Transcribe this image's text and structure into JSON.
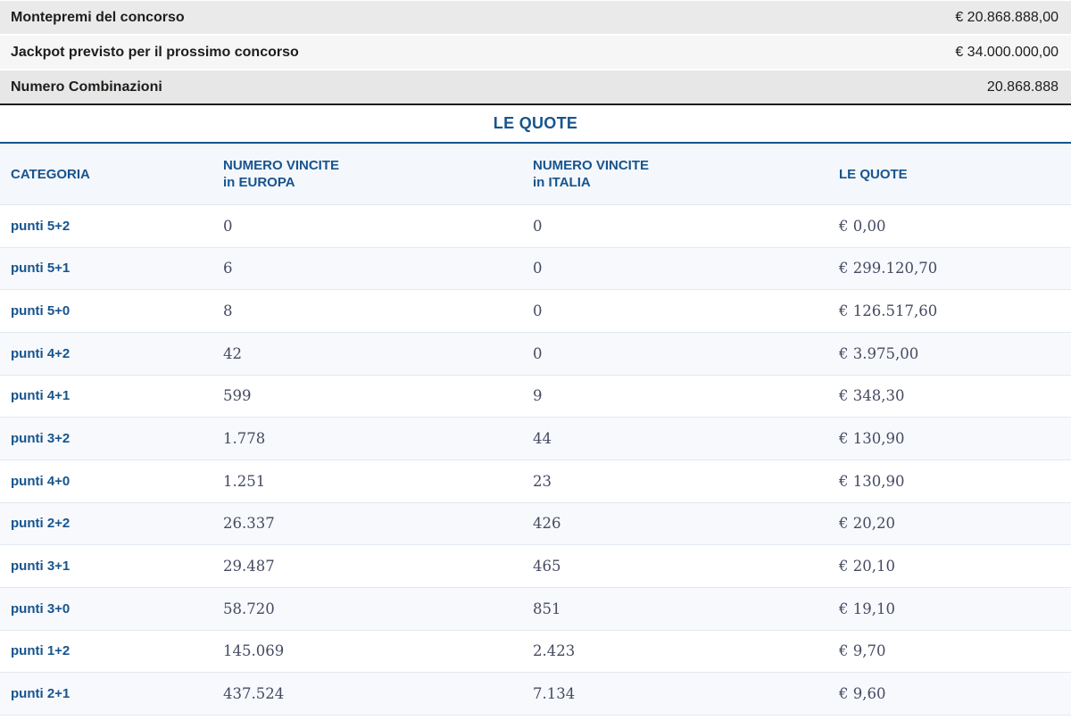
{
  "summary": {
    "rows": [
      {
        "label": "Montepremi del concorso",
        "value": "€ 20.868.888,00"
      },
      {
        "label": "Jackpot previsto per il prossimo concorso",
        "value": "€ 34.000.000,00"
      },
      {
        "label": "Numero Combinazioni",
        "value": "20.868.888"
      }
    ]
  },
  "section_title": "LE QUOTE",
  "table": {
    "columns": [
      {
        "label": "CATEGORIA"
      },
      {
        "line1": "NUMERO VINCITE",
        "line2": "in EUROPA"
      },
      {
        "line1": "NUMERO VINCITE",
        "line2": "in ITALIA"
      },
      {
        "label": "LE QUOTE"
      }
    ],
    "rows": [
      {
        "categoria": "punti 5+2",
        "vincite_europa": "0",
        "vincite_italia": "0",
        "quota": "€ 0,00"
      },
      {
        "categoria": "punti 5+1",
        "vincite_europa": "6",
        "vincite_italia": "0",
        "quota": "€ 299.120,70"
      },
      {
        "categoria": "punti 5+0",
        "vincite_europa": "8",
        "vincite_italia": "0",
        "quota": "€ 126.517,60"
      },
      {
        "categoria": "punti 4+2",
        "vincite_europa": "42",
        "vincite_italia": "0",
        "quota": "€ 3.975,00"
      },
      {
        "categoria": "punti 4+1",
        "vincite_europa": "599",
        "vincite_italia": "9",
        "quota": "€ 348,30"
      },
      {
        "categoria": "punti 3+2",
        "vincite_europa": "1.778",
        "vincite_italia": "44",
        "quota": "€ 130,90"
      },
      {
        "categoria": "punti 4+0",
        "vincite_europa": "1.251",
        "vincite_italia": "23",
        "quota": "€ 130,90"
      },
      {
        "categoria": "punti 2+2",
        "vincite_europa": "26.337",
        "vincite_italia": "426",
        "quota": "€ 20,20"
      },
      {
        "categoria": "punti 3+1",
        "vincite_europa": "29.487",
        "vincite_italia": "465",
        "quota": "€ 20,10"
      },
      {
        "categoria": "punti 3+0",
        "vincite_europa": "58.720",
        "vincite_italia": "851",
        "quota": "€ 19,10"
      },
      {
        "categoria": "punti 1+2",
        "vincite_europa": "145.069",
        "vincite_italia": "2.423",
        "quota": "€ 9,70"
      },
      {
        "categoria": "punti 2+1",
        "vincite_europa": "437.524",
        "vincite_italia": "7.134",
        "quota": "€ 9,60"
      }
    ]
  },
  "colors": {
    "accent_blue": "#17548e",
    "row_alt_background": "#f7f9fc",
    "summary_gray": "#eaeaea",
    "number_ink": "#454a61"
  }
}
